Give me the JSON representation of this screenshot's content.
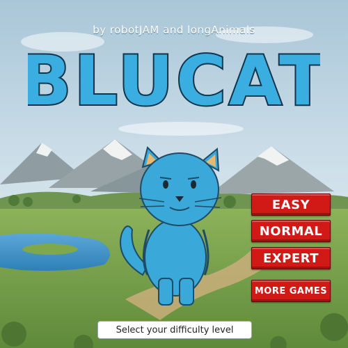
{
  "credit": "by robotJAM and longAnimals",
  "logo_text": "BLUCAT",
  "menu": {
    "easy": "EASY",
    "normal": "NORMAL",
    "expert": "EXPERT",
    "more_games": "MORE GAMES"
  },
  "status_text": "Select your difficulty level",
  "colors": {
    "sky": "#bcd6e6",
    "logo_blue": "#3aaee0",
    "button_red": "#d11a16",
    "grass": "#7ea24a",
    "cat_blue": "#3aa8d8"
  }
}
